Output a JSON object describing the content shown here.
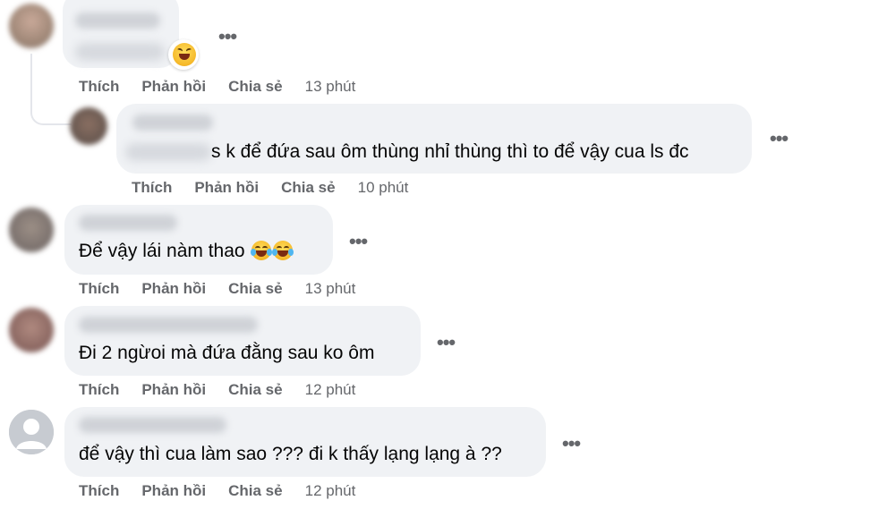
{
  "actions": {
    "like": "Thích",
    "reply": "Phản hồi",
    "share": "Chia sẻ"
  },
  "comments": [
    {
      "text": "",
      "time": "13 phút",
      "reaction_icon": "laughing-face-emoji"
    },
    {
      "text": "s k để đứa sau ôm thùng nhỉ thùng thì to để vậy cua ls đc",
      "time": "10 phút"
    },
    {
      "text": "Để vậy lái nàm thao",
      "time": "13 phút",
      "inline_icons": [
        "tears-of-joy-emoji",
        "tears-of-joy-emoji"
      ]
    },
    {
      "text": "Đi 2 ngừoi mà đứa đằng sau ko ôm",
      "time": "12 phút"
    },
    {
      "text": "để vậy thì cua làm sao ??? đi k thấy lạng lạng à ??",
      "time": "12 phút",
      "avatar_icon": "default-profile-icon"
    }
  ],
  "more_icon": "more-options-icon",
  "colors": {
    "bubble": "#f0f2f5",
    "meta_text": "#65676b",
    "body_text": "#050505"
  }
}
